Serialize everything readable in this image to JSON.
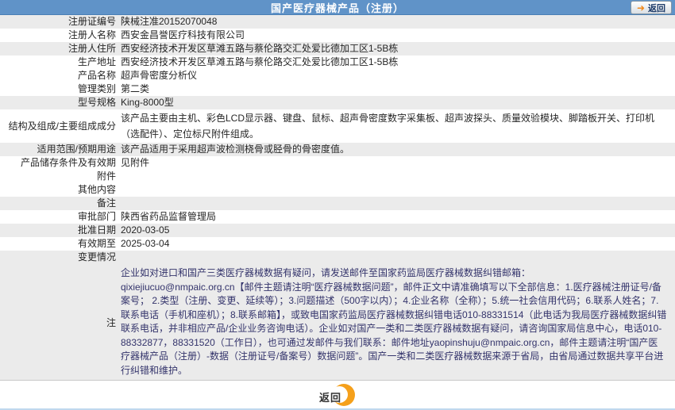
{
  "header": {
    "title": "国产医疗器械产品（注册）",
    "back_label": "返回"
  },
  "table": {
    "rows": [
      {
        "label": "注册证编号",
        "value": "陕械注准20152070048"
      },
      {
        "label": "注册人名称",
        "value": "西安金昌誉医疗科技有限公司"
      },
      {
        "label": "注册人住所",
        "value": "西安经济技术开发区草滩五路与蔡伦路交汇处爱比德加工区1-5B栋"
      },
      {
        "label": "生产地址",
        "value": "西安经济技术开发区草滩五路与蔡伦路交汇处爱比德加工区1-5B栋"
      },
      {
        "label": "产品名称",
        "value": "超声骨密度分析仪"
      },
      {
        "label": "管理类别",
        "value": "第二类"
      },
      {
        "label": "型号规格",
        "value": "King-8000型"
      },
      {
        "label": "结构及组成/主要组成成分",
        "value": "该产品主要由主机、彩色LCD显示器、键盘、鼠标、超声骨密度数字采集板、超声波探头、质量效验模块、脚踏板开关、打印机（选配件）、定位标尺附件组成。"
      },
      {
        "label": "适用范围/预期用途",
        "value": "该产品适用于采用超声波检测桡骨或胫骨的骨密度值。"
      },
      {
        "label": "产品储存条件及有效期",
        "value": "见附件"
      },
      {
        "label": "附件",
        "value": ""
      },
      {
        "label": "其他内容",
        "value": ""
      },
      {
        "label": "备注",
        "value": ""
      },
      {
        "label": "审批部门",
        "value": "陕西省药品监督管理局"
      },
      {
        "label": "批准日期",
        "value": "2020-03-05"
      },
      {
        "label": "有效期至",
        "value": "2025-03-04"
      },
      {
        "label": "变更情况",
        "value": ""
      }
    ]
  },
  "note": {
    "label": "注",
    "line1": "企业如对进口和国产三类医疗器械数据有疑问，请发送邮件至国家药监局医疗器械数据纠错邮箱：",
    "body": "qixiejiucuo@nmpaic.org.cn【邮件主题请注明“医疗器械数据问题”，邮件正文中请准确填写以下全部信息：1.医疗器械注册证号/备案号； 2.类型（注册、变更、延续等）；3.问题描述（500字以内）；4.企业名称（全称）；5.统一社会信用代码；6.联系人姓名；7.联系电话（手机和座机）；8.联系邮箱】，或致电国家药监局医疗器械数据纠错电话010-88331514（此电话为我局医疗器械数据纠错联系电话，并非相应产品/企业业务咨询电话）。企业如对国产一类和二类医疗器械数据有疑问，请咨询国家局信息中心，电话010-88332877，88331520（工作日），也可通过发邮件与我们联系：邮件地址yaopinshuju@nmpaic.org.cn，邮件主题请注明“国产医疗器械产品（注册）-数据（注册证号/备案号）数据问题”。国产一类和二类医疗器械数据来源于省局，由省局通过数据共享平台进行纠错和维护。"
  },
  "footer": {
    "back_label": "返回"
  },
  "colors": {
    "titlebar_blue": "#6093C8",
    "row_shaded_gray": "#EBEBEB",
    "note_text_navy": "#33336B",
    "accent_orange": "#F5A01B"
  }
}
